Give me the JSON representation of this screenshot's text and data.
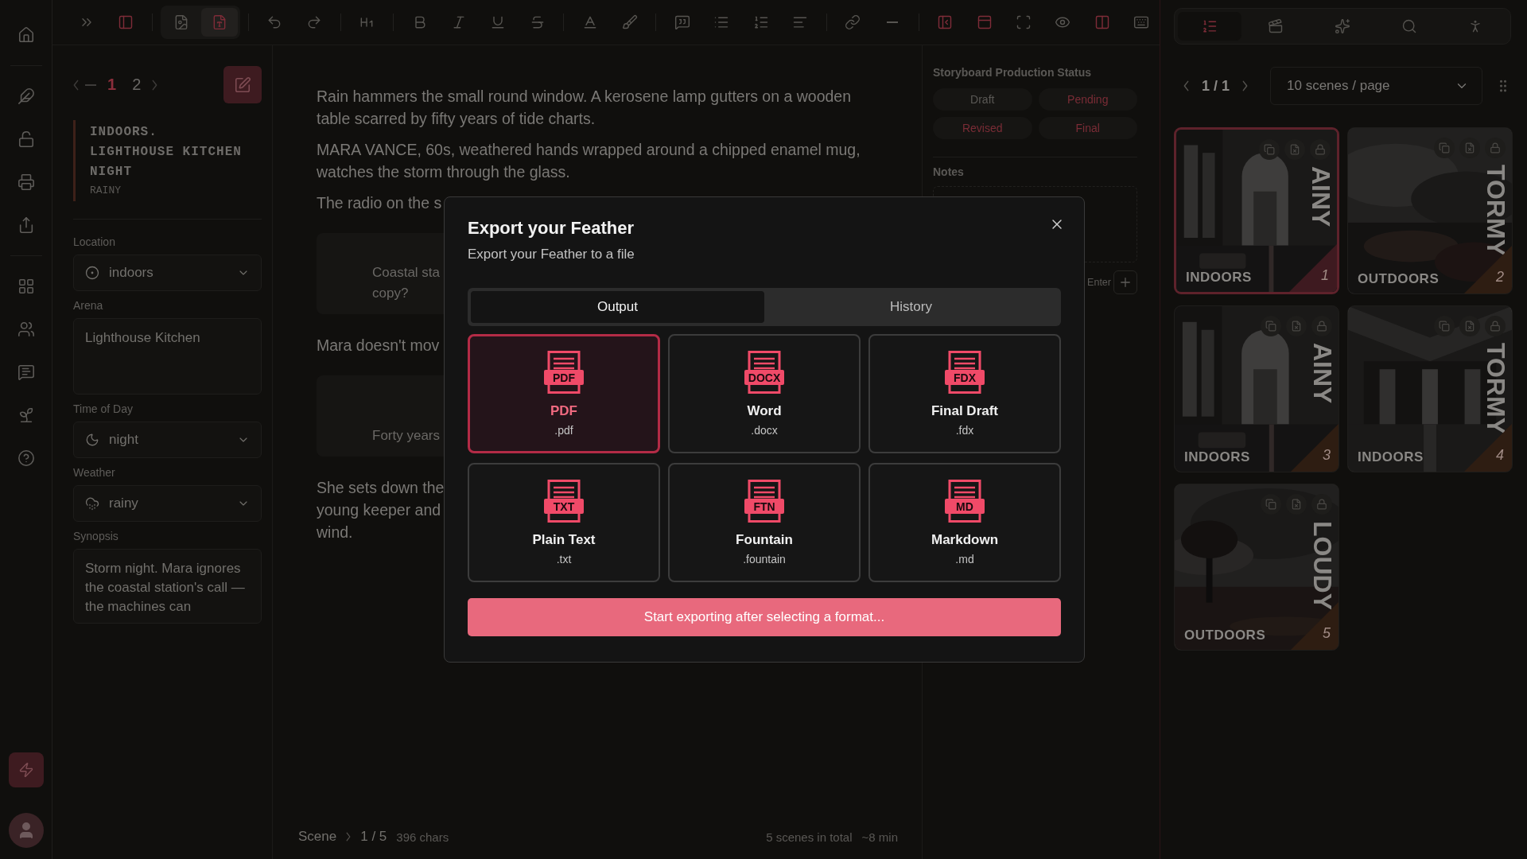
{
  "toolbar": {
    "groups": [
      [
        {
          "active": false
        },
        {
          "active": true
        }
      ],
      [
        {
          "active": false
        },
        {
          "active": true
        }
      ],
      [
        {
          "active": false
        },
        {
          "active": false
        }
      ],
      [
        {
          "active": false
        }
      ],
      [
        {
          "active": false
        },
        {
          "active": false
        },
        {
          "active": false
        },
        {
          "active": false
        }
      ],
      [
        {
          "active": false
        },
        {
          "active": false
        }
      ],
      [
        {
          "active": false
        },
        {
          "active": false
        },
        {
          "active": false
        },
        {
          "active": false
        }
      ],
      [
        {
          "active": false
        },
        {
          "active": false
        }
      ],
      [
        {
          "active": true
        },
        {
          "active": true
        },
        {
          "active": false
        },
        {
          "active": false
        },
        {
          "active": true
        },
        {
          "active": false
        }
      ]
    ]
  },
  "storyboard_tabs": [
    {
      "selected": true
    },
    {
      "selected": false
    },
    {
      "selected": false
    },
    {
      "selected": false
    },
    {
      "selected": false
    }
  ],
  "scene_panel": {
    "pages": [
      {
        "label": "1",
        "selected": true
      },
      {
        "label": "2",
        "selected": false
      }
    ],
    "heading": [
      "INDOORS.",
      "LIGHTHOUSE KITCHEN",
      "NIGHT"
    ],
    "heading_tag": "RAINY",
    "fields": [
      {
        "kind": "select",
        "label": "Location",
        "value": "indoors"
      },
      {
        "kind": "text",
        "label": "Arena",
        "value": "Lighthouse Kitchen"
      },
      {
        "kind": "select",
        "label": "Time of Day",
        "value": "night"
      },
      {
        "kind": "select",
        "label": "Weather",
        "value": "rainy"
      },
      {
        "kind": "text",
        "label": "Synopsis",
        "value": "Storm night. Mara ignores the coastal station's call — the machines can"
      }
    ]
  },
  "script": [
    {
      "kind": "action",
      "lines": [
        "Rain hammers the small round window. A kerosene lamp gutters on a wooden",
        "table scarred by fifty years of tide charts."
      ]
    },
    {
      "kind": "action",
      "lines": [
        "MARA VANCE, 60s, weathered hands wrapped around a chipped enamel mug,",
        "watches the storm through the glass."
      ]
    },
    {
      "kind": "action",
      "lines": [
        "The radio on the s"
      ]
    },
    {
      "kind": "card",
      "lines": [
        "Coastal sta",
        "copy?"
      ]
    },
    {
      "kind": "action",
      "lines": [
        "Mara doesn't mov"
      ]
    },
    {
      "kind": "card",
      "lines": [
        "Forty years"
      ]
    },
    {
      "kind": "action",
      "lines": [
        "She sets down the",
        "young keeper and",
        "wind."
      ]
    }
  ],
  "status_bar": {
    "crumb": "Scene",
    "position": "1 / 5",
    "chars": "396 chars",
    "total": "5 scenes in total",
    "duration": "~8 min"
  },
  "side_panel": {
    "title": "Storyboard Production Status",
    "chips": [
      {
        "label": "Draft",
        "color": "#5a5855"
      },
      {
        "label": "Pending",
        "color": "#7a2c36"
      },
      {
        "label": "Revised",
        "color": "#7a2c36"
      },
      {
        "label": "Final",
        "color": "#7a2c36"
      }
    ],
    "notes_label": "Notes",
    "hint": "Enter"
  },
  "storyboard": {
    "pager": "1 / 1",
    "page_size": "10 scenes / page",
    "scenes": [
      {
        "number": "1",
        "location": "INDOORS",
        "weather": "AINY",
        "selected": true
      },
      {
        "number": "2",
        "location": "OUTDOORS",
        "weather": "TORMY",
        "selected": false
      },
      {
        "number": "3",
        "location": "INDOORS",
        "weather": "AINY",
        "selected": false
      },
      {
        "number": "4",
        "location": "INDOORS",
        "weather": "TORMY",
        "selected": false
      },
      {
        "number": "5",
        "location": "OUTDOORS",
        "weather": "LOUDY",
        "selected": false
      }
    ]
  },
  "dialog": {
    "title": "Export your Feather",
    "subtitle": "Export your Feather to a file",
    "tabs": [
      {
        "label": "Output",
        "selected": true
      },
      {
        "label": "History",
        "selected": false
      }
    ],
    "formats": [
      {
        "badge": "PDF",
        "name": "PDF",
        "ext": ".pdf",
        "selected": true
      },
      {
        "badge": "DOCX",
        "name": "Word",
        "ext": ".docx",
        "selected": false
      },
      {
        "badge": "FDX",
        "name": "Final Draft",
        "ext": ".fdx",
        "selected": false
      },
      {
        "badge": "TXT",
        "name": "Plain Text",
        "ext": ".txt",
        "selected": false
      },
      {
        "badge": "FTN",
        "name": "Fountain",
        "ext": ".fountain",
        "selected": false
      },
      {
        "badge": "MD",
        "name": "Markdown",
        "ext": ".md",
        "selected": false
      }
    ],
    "action": "Start exporting after selecting a format..."
  }
}
